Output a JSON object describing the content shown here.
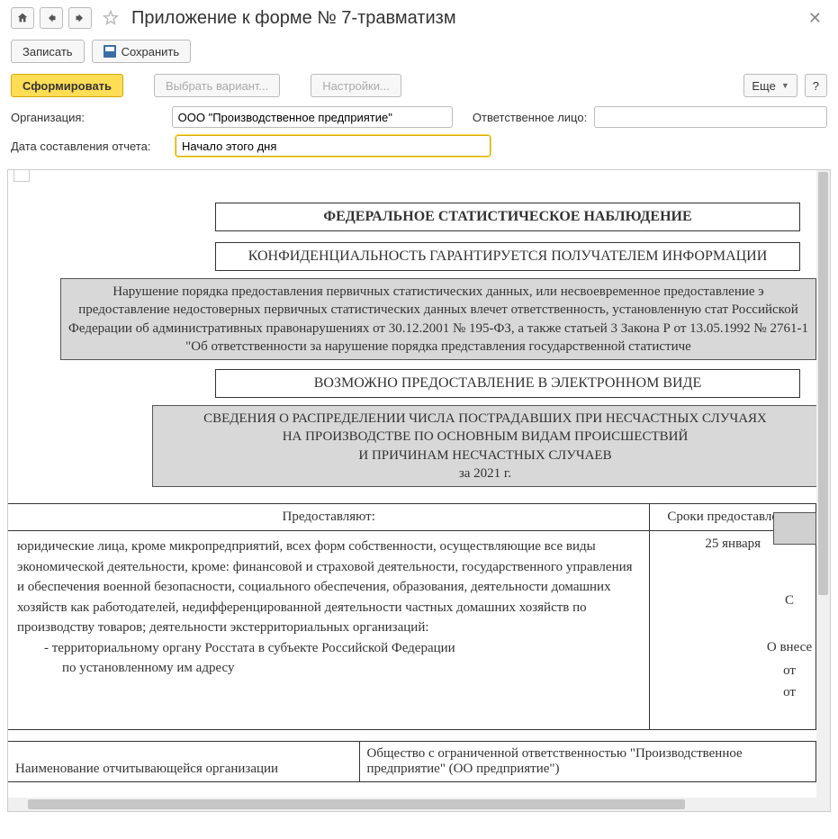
{
  "header": {
    "title": "Приложение к форме № 7-травматизм"
  },
  "toolbar1": {
    "write": "Записать",
    "save": "Сохранить"
  },
  "toolbar2": {
    "generate": "Сформировать",
    "choose_variant": "Выбрать вариант...",
    "settings": "Настройки...",
    "more": "Еще",
    "help": "?"
  },
  "form": {
    "org_label": "Организация:",
    "org_value": "ООО \"Производственное предприятие\"",
    "resp_label": "Ответственное лицо:",
    "resp_value": "",
    "date_label": "Дата составления отчета:",
    "date_value": "Начало этого дня"
  },
  "doc": {
    "title1": "ФЕДЕРАЛЬНОЕ СТАТИСТИЧЕСКОЕ НАБЛЮДЕНИЕ",
    "title2": "КОНФИДЕНЦИАЛЬНОСТЬ ГАРАНТИРУЕТСЯ ПОЛУЧАТЕЛЕМ ИНФОРМАЦИИ",
    "warning": "Нарушение порядка предоставления первичных статистических данных, или несвоевременное предоставление э предоставление недостоверных первичных статистических данных влечет ответственность, установленную стат Российской Федерации об административных правонарушениях от 30.12.2001 № 195-ФЗ, а также статьей 3 Закона Р от 13.05.1992 № 2761-1 \"Об ответственности за нарушение порядка представления государственной статистиче",
    "eform": "ВОЗМОЖНО ПРЕДОСТАВЛЕНИЕ В ЭЛЕКТРОННОМ ВИДЕ",
    "info_l1": "СВЕДЕНИЯ О РАСПРЕДЕЛЕНИИ ЧИСЛА ПОСТРАДАВШИХ ПРИ НЕСЧАСТНЫХ СЛУЧАЯХ",
    "info_l2": "НА ПРОИЗВОДСТВЕ ПО ОСНОВНЫМ ВИДАМ ПРОИСШЕСТВИЙ",
    "info_l3": "И ПРИЧИНАМ НЕСЧАСТНЫХ СЛУЧАЕВ",
    "info_l4": "за 2021 г.",
    "col1_header": "Предоставляют:",
    "col2_header": "Сроки предоставления",
    "col1_text_p1": "юридические лица, кроме микропредприятий, всех форм собственности, осуществляющие все виды экономической деятельности, кроме: финансовой и страховой деятельности, государственного управления и обеспечения военной безопасности, социального обеспечения, образования, деятельности домашних хозяйств как работодателей, недифференцированной деятельности частных домашних хозяйств по производству товаров; деятельности экстерриториальных организаций:",
    "col1_bullet1": "-   территориальному органу Росстата в субъекте Российской Федерации",
    "col1_bullet1b": "по установленному им адресу",
    "col2_text": "25 января",
    "side_c": "С",
    "side_o": "О внесе",
    "side_ot1": "от",
    "side_ot2": "от",
    "org_name_label": "Наименование отчитывающейся организации",
    "org_name_value": "Общество с ограниченной ответственностью \"Производственное предприятие\" (ОО предприятие\")"
  }
}
